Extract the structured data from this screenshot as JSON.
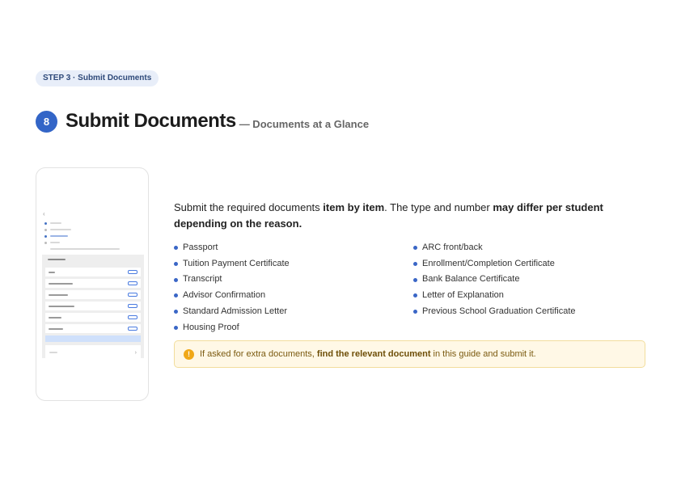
{
  "step_pill": "STEP 3 · Submit Documents",
  "header": {
    "number": "8",
    "title": "Submit Documents",
    "subtitle": "— Documents at a Glance"
  },
  "intro": {
    "part1": "Submit the required documents ",
    "bold1": "item by item",
    "part2": ". The type and number ",
    "bold2": "may differ per student depending on the reason."
  },
  "documents_left": [
    "Passport",
    "Tuition Payment Certificate",
    "Transcript",
    "Advisor Confirmation",
    "Standard Admission Letter",
    "Housing Proof"
  ],
  "documents_right": [
    "ARC front/back",
    "Enrollment/Completion Certificate",
    "Bank Balance Certificate",
    "Letter of Explanation",
    "Previous School Graduation Certificate"
  ],
  "notice": {
    "icon": "warning-icon",
    "part1": "If asked for extra documents, ",
    "bold": "find the relevant document",
    "part2": " in this guide and submit it."
  },
  "colors": {
    "accent": "#3365c7",
    "pill_bg": "#e8eef9",
    "notice_bg": "#fff8e6",
    "notice_border": "#f2dd9c",
    "warning": "#f0a818"
  }
}
